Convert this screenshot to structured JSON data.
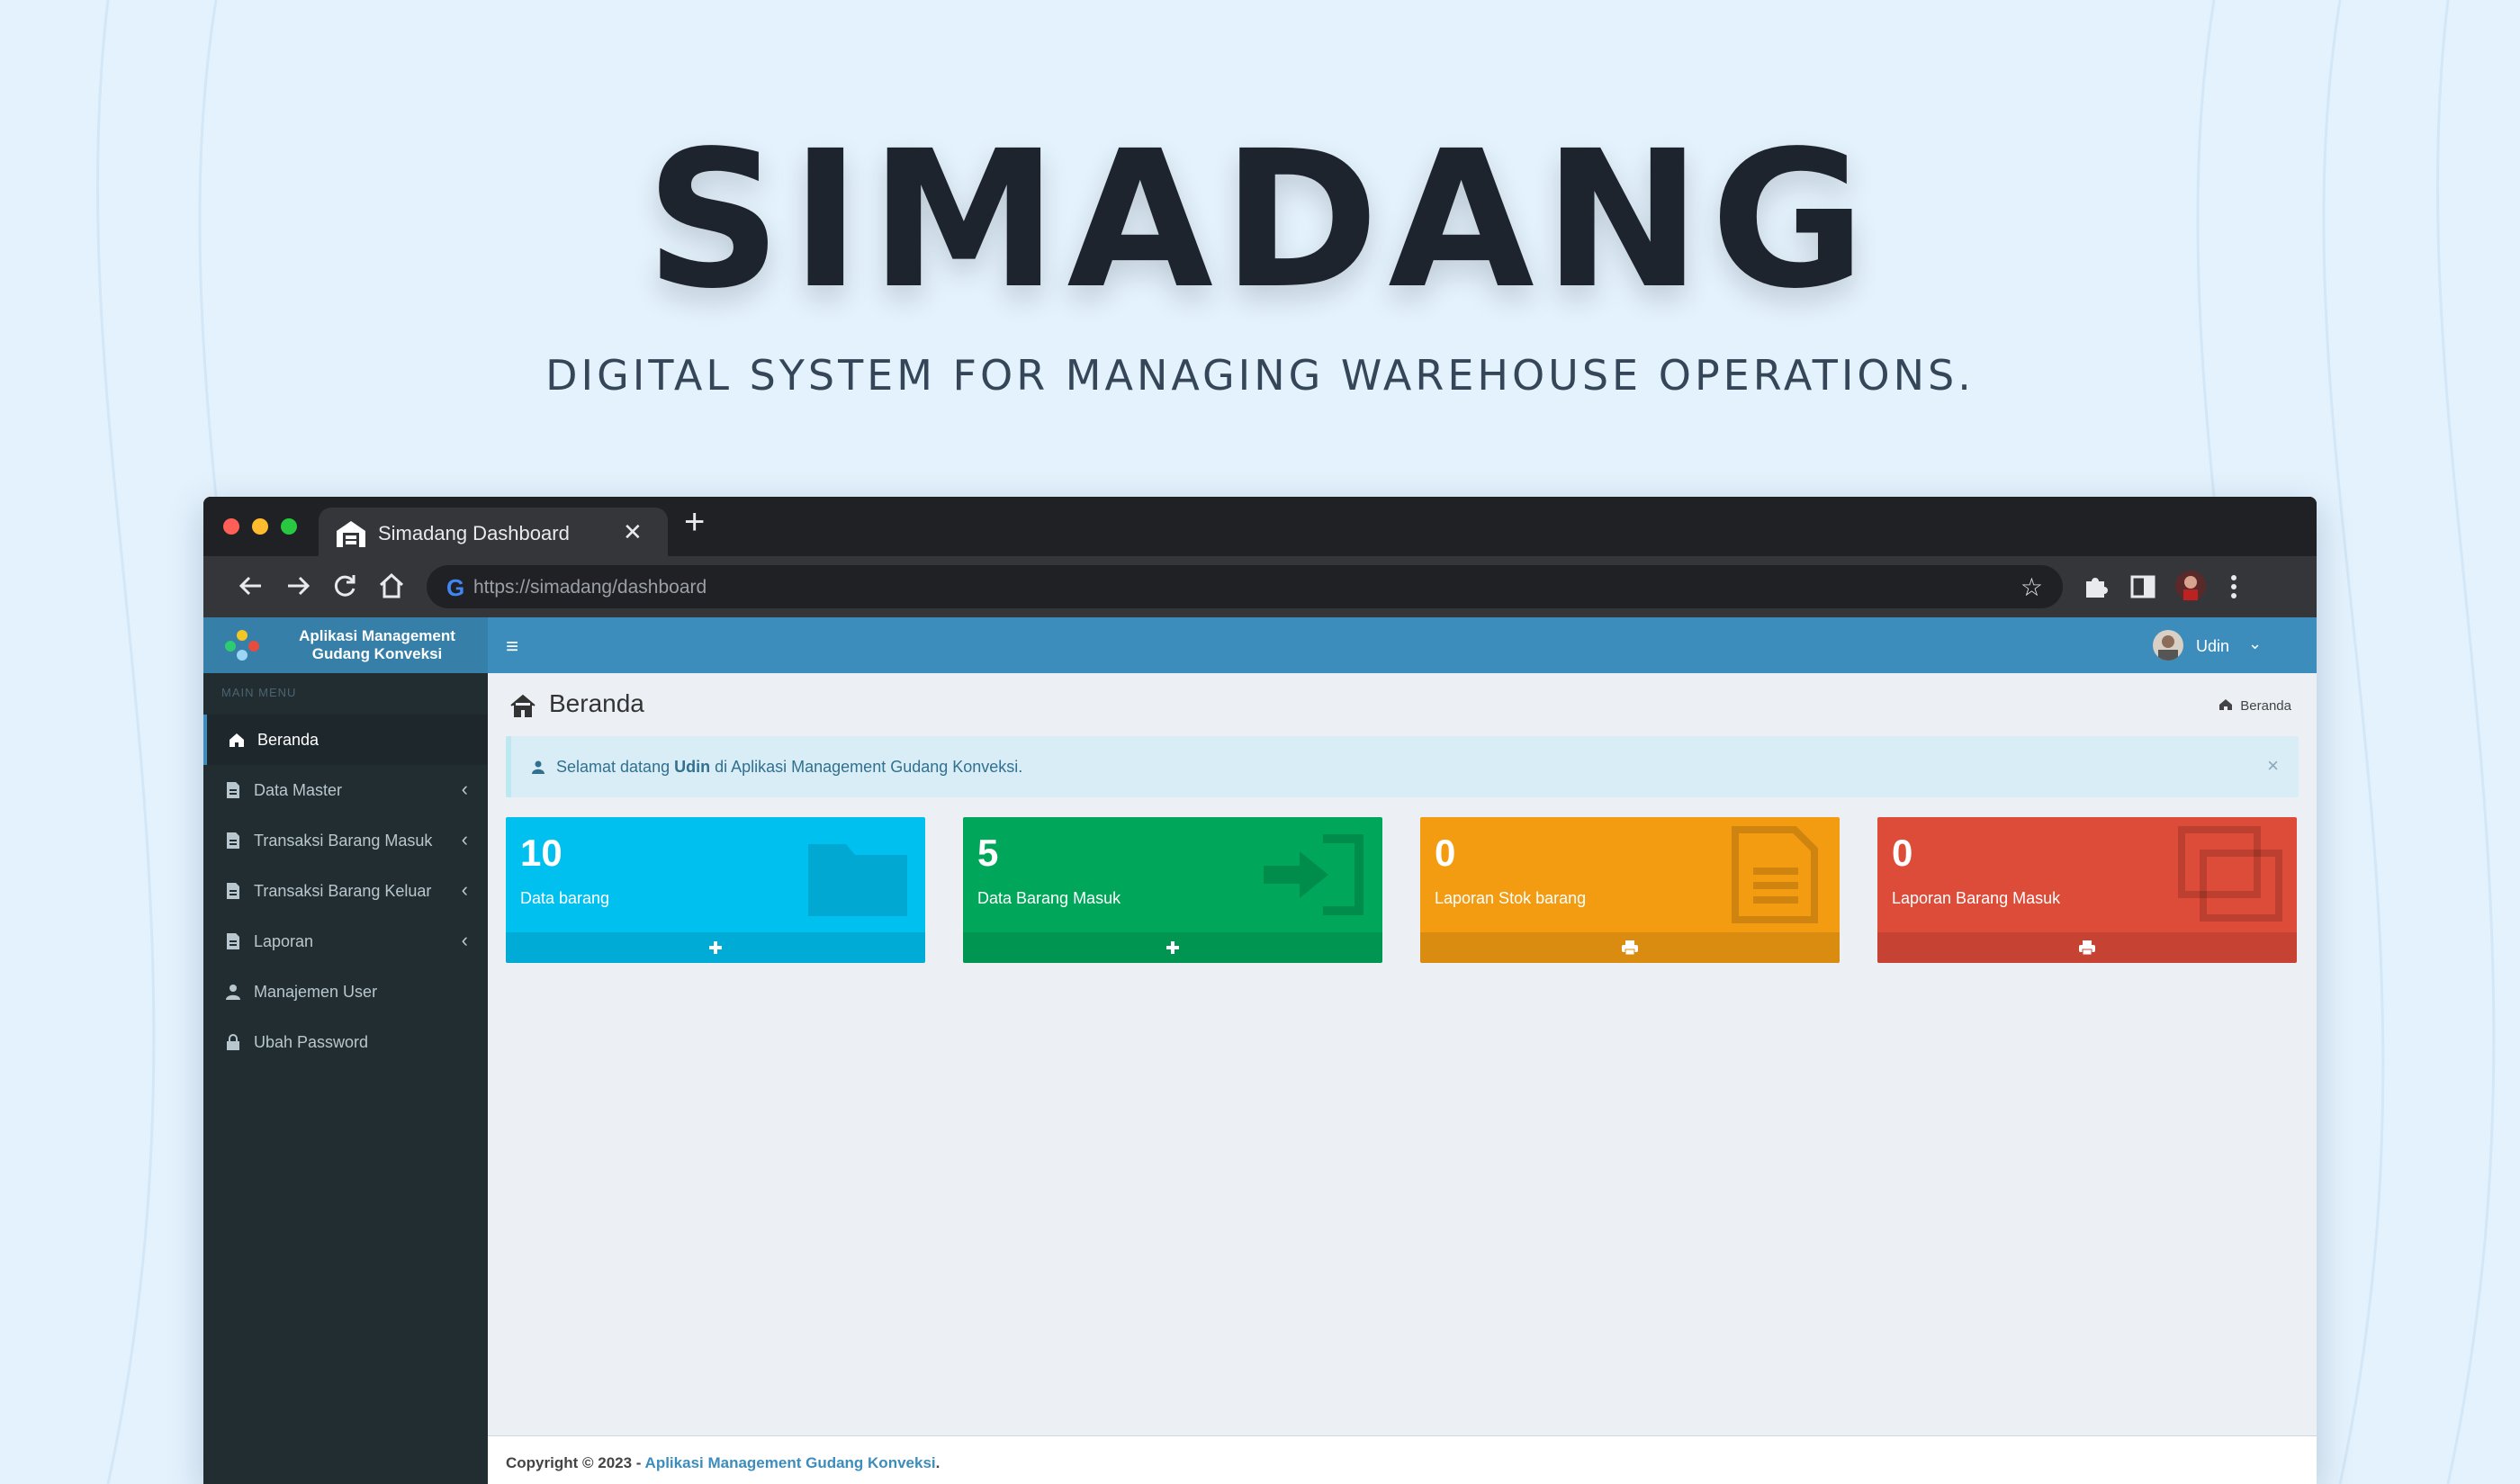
{
  "hero": {
    "title": "SIMADANG",
    "subtitle": "DIGITAL SYSTEM FOR MANAGING WAREHOUSE OPERATIONS."
  },
  "browser": {
    "tab_title": "Simadang Dashboard",
    "tab_close": "✕",
    "new_tab": "+",
    "url": "https://simadang/dashboard",
    "google_letter": "G",
    "star": "☆"
  },
  "app": {
    "logo_text": "Aplikasi Management Gudang Konveksi",
    "hamburger": "≡",
    "user_name": "Udin",
    "user_caret": "⌄",
    "sidebar": {
      "header": "MAIN MENU",
      "items": [
        {
          "label": "Beranda",
          "icon": "home-icon",
          "has_caret": false,
          "active": true
        },
        {
          "label": "Data Master",
          "icon": "file-icon",
          "has_caret": true,
          "active": false
        },
        {
          "label": "Transaksi Barang Masuk",
          "icon": "file-icon",
          "has_caret": true,
          "active": false
        },
        {
          "label": "Transaksi Barang Keluar",
          "icon": "file-icon",
          "has_caret": true,
          "active": false
        },
        {
          "label": "Laporan",
          "icon": "file-icon",
          "has_caret": true,
          "active": false
        },
        {
          "label": "Manajemen User",
          "icon": "user-icon",
          "has_caret": false,
          "active": false
        },
        {
          "label": "Ubah Password",
          "icon": "lock-icon",
          "has_caret": false,
          "active": false
        }
      ],
      "caret": "‹"
    },
    "page_title": "Beranda",
    "breadcrumb": "Beranda",
    "alert": {
      "prefix": "Selamat datang ",
      "user": "Udin",
      "suffix": " di Aplikasi Management Gudang Konveksi.",
      "close": "×"
    },
    "boxes": [
      {
        "value": "10",
        "label": "Data barang",
        "color": "#00c0ef",
        "icon": "folder-icon",
        "footer_icon": "plus-icon"
      },
      {
        "value": "5",
        "label": "Data Barang Masuk",
        "color": "#00a65a",
        "icon": "sign-in-icon",
        "footer_icon": "plus-icon"
      },
      {
        "value": "0",
        "label": "Laporan Stok barang",
        "color": "#f39c12",
        "icon": "document-icon",
        "footer_icon": "print-icon"
      },
      {
        "value": "0",
        "label": "Laporan Barang Masuk",
        "color": "#dd4b39",
        "icon": "copy-icon",
        "footer_icon": "print-icon"
      }
    ],
    "footer": {
      "copyright": "Copyright © 2023 - ",
      "link": "Aplikasi Management Gudang Konveksi",
      "end": "."
    }
  },
  "colors": {
    "background": "#e4f2fd",
    "navbar": "#3c8dbc",
    "logo_bar": "#367fa9",
    "sidebar": "#222d32"
  }
}
